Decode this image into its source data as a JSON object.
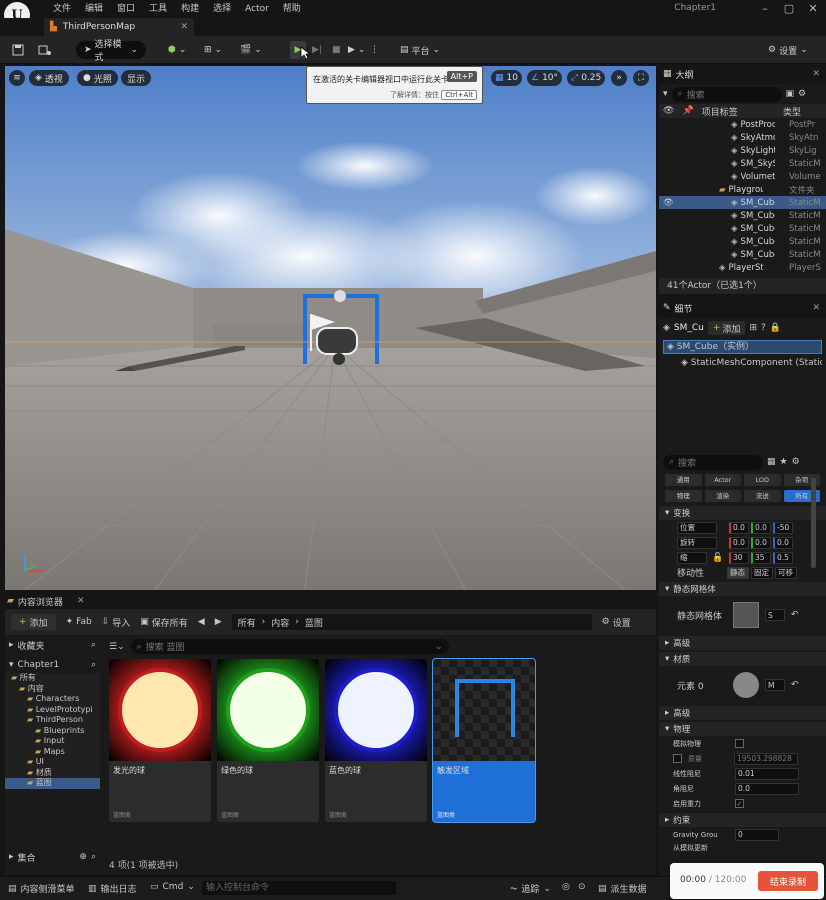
{
  "titlebar": {
    "menu": [
      "文件",
      "编辑",
      "窗口",
      "工具",
      "构建",
      "选择",
      "Actor",
      "帮助"
    ],
    "project": "Chapter1"
  },
  "tabs": {
    "map": "ThirdPersonMap"
  },
  "toolbar": {
    "mode": "选择模式",
    "platform": "平台",
    "settings": "设置"
  },
  "viewport": {
    "perspective": "透视",
    "lit": "光照",
    "show": "显示",
    "grid": "10",
    "angle": "10°",
    "scale": "0.25"
  },
  "tooltip": {
    "text": "在激活的关卡编辑器视口中运行此关卡",
    "key": "Alt+P",
    "more": "了解详情：按住",
    "more_key": "Ctrl+Alt"
  },
  "outliner": {
    "title": "大纲",
    "search": "搜索",
    "col_label": "项目标签",
    "col_type": "类型",
    "rows": [
      {
        "name": "PostProc",
        "type": "PostPr",
        "indent": 2
      },
      {
        "name": "SkyAtmo",
        "type": "SkyAtn",
        "indent": 2
      },
      {
        "name": "SkyLight",
        "type": "SkyLig",
        "indent": 2
      },
      {
        "name": "SM_SkyS",
        "type": "StaticM",
        "indent": 2
      },
      {
        "name": "Volumetr",
        "type": "Volume",
        "indent": 2
      },
      {
        "name": "Playgroun",
        "type": "文件夹",
        "indent": 1
      },
      {
        "name": "SM_Cube",
        "type": "StaticM",
        "indent": 2
      },
      {
        "name": "SM_Cube",
        "type": "StaticM",
        "indent": 2
      },
      {
        "name": "SM_Cube",
        "type": "StaticM",
        "indent": 2
      },
      {
        "name": "SM_Cube",
        "type": "StaticM",
        "indent": 2
      },
      {
        "name": "SM_Cube",
        "type": "StaticM",
        "indent": 2
      },
      {
        "name": "PlayerStart",
        "type": "PlayerS",
        "indent": 1
      }
    ],
    "status": "41个Actor（已选1个）"
  },
  "details": {
    "title": "细节",
    "actor": "SM_Cu",
    "add": "添加",
    "instance": "SM_Cube（实例）",
    "component": "StaticMeshComponent (StaticM",
    "search": "搜索",
    "filters": [
      "通用",
      "Actor",
      "LOD",
      "杂项",
      "物理",
      "渲染",
      "流送",
      "所有"
    ],
    "sec_transform": "变换",
    "loc_label": "位置",
    "loc": [
      "0.0",
      "0.0",
      "-50"
    ],
    "rot_label": "旋转",
    "rot": [
      "0.0",
      "0.0",
      "0.0"
    ],
    "scale_label": "缩",
    "scale": [
      "30",
      "35",
      "0.5"
    ],
    "mobility_label": "移动性",
    "mobility": [
      "静态",
      "固定",
      "可移"
    ],
    "sec_mesh": "静态网格体",
    "mesh_label": "静态网格体",
    "mesh_val": "S",
    "sec_advanced": "高级",
    "sec_material": "材质",
    "element_label": "元素 0",
    "element_val": "M",
    "sec_shadow": "高级",
    "sec_physics": "物理",
    "simulate": "模拟物理",
    "mass": "质量",
    "mass_val": "19503.298828",
    "linear_damping": "线性阻尼",
    "linear_val": "0.01",
    "angular_damping": "角阻尼",
    "angular_val": "0.0",
    "gravity": "启用重力",
    "sec_constraints": "约束",
    "gravity_group": "Gravity Grou",
    "gravity_group_val": "0",
    "lock": "从模拟更新"
  },
  "content": {
    "tab": "内容浏览器",
    "add": "添加",
    "fab": "Fab",
    "import": "导入",
    "save_all": "保存所有",
    "path": [
      "所有",
      "内容",
      "蓝图"
    ],
    "settings": "设置",
    "search": "搜索 蓝图",
    "favorites": "收藏夹",
    "project": "Chapter1",
    "tree": [
      {
        "name": "所有",
        "indent": 0
      },
      {
        "name": "内容",
        "indent": 1
      },
      {
        "name": "Characters",
        "indent": 2
      },
      {
        "name": "LevelPrototypi",
        "indent": 2
      },
      {
        "name": "ThirdPerson",
        "indent": 2
      },
      {
        "name": "Blueprints",
        "indent": 3
      },
      {
        "name": "Input",
        "indent": 3
      },
      {
        "name": "Maps",
        "indent": 3
      },
      {
        "name": "UI",
        "indent": 2
      },
      {
        "name": "材质",
        "indent": 2
      },
      {
        "name": "蓝图",
        "indent": 2
      }
    ],
    "collections": "集合",
    "assets": [
      {
        "name": "发光的球",
        "type": "蓝图类",
        "color": "#c01e1e"
      },
      {
        "name": "绿色的球",
        "type": "蓝图类",
        "color": "#1ea01e"
      },
      {
        "name": "蓝色的球",
        "type": "蓝图类",
        "color": "#1e1ec8"
      },
      {
        "name": "触发区域",
        "type": "蓝图类",
        "color": "#2a86e6"
      }
    ],
    "status": "4 项(1 项被选中)"
  },
  "bottombar": {
    "drawer": "内容侧滑菜单",
    "log": "输出日志",
    "cmd": "Cmd",
    "cmd_placeholder": "输入控制台命令",
    "trace": "追踪",
    "derived": "派生数据"
  },
  "recorder": {
    "time": "00:00",
    "total": "/ 120:00",
    "stop": "结束录制"
  }
}
